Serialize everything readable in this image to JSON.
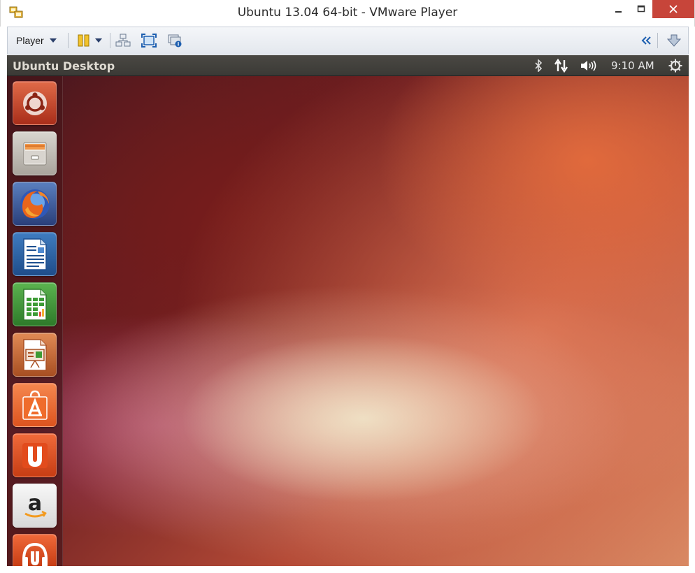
{
  "window": {
    "title": "Ubuntu 13.04 64-bit - VMware Player",
    "buttons": [
      "minimize",
      "maximize",
      "close"
    ],
    "close_color": "#c7453a"
  },
  "toolbar": {
    "player_menu_label": "Player",
    "icons": [
      "pause-icon",
      "dropdown-arrow-icon",
      "send-ctrl-alt-del-icon",
      "fullscreen-icon",
      "unity-mode-icon",
      "collapse-toolbar-icon",
      "download-icon"
    ]
  },
  "ubuntu": {
    "panel_title": "Ubuntu Desktop",
    "indicators": [
      "bluetooth-icon",
      "network-icon",
      "volume-icon"
    ],
    "clock": "9:10 AM",
    "session_icon": "gear-power-icon",
    "launcher_items": [
      {
        "name": "dash-home",
        "icon": "ubuntu-logo-icon",
        "color": "#c23d1a"
      },
      {
        "name": "files",
        "icon": "file-cabinet-icon",
        "color": "#c9c6c0"
      },
      {
        "name": "firefox",
        "icon": "firefox-icon",
        "color": "#e0661f"
      },
      {
        "name": "libreoffice-writer",
        "icon": "writer-icon",
        "color": "#2e66a8"
      },
      {
        "name": "libreoffice-calc",
        "icon": "calc-icon",
        "color": "#3d9b35"
      },
      {
        "name": "libreoffice-impress",
        "icon": "impress-icon",
        "color": "#c0622e"
      },
      {
        "name": "ubuntu-software-center",
        "icon": "software-center-icon",
        "color": "#ef6c2c"
      },
      {
        "name": "ubuntu-one",
        "icon": "ubuntu-one-icon",
        "color": "#e24b1c"
      },
      {
        "name": "amazon",
        "icon": "amazon-icon",
        "color": "#f2f2f2"
      },
      {
        "name": "ubuntu-one-music",
        "icon": "ubuntu-one-music-icon",
        "color": "#e24b1c"
      }
    ]
  }
}
